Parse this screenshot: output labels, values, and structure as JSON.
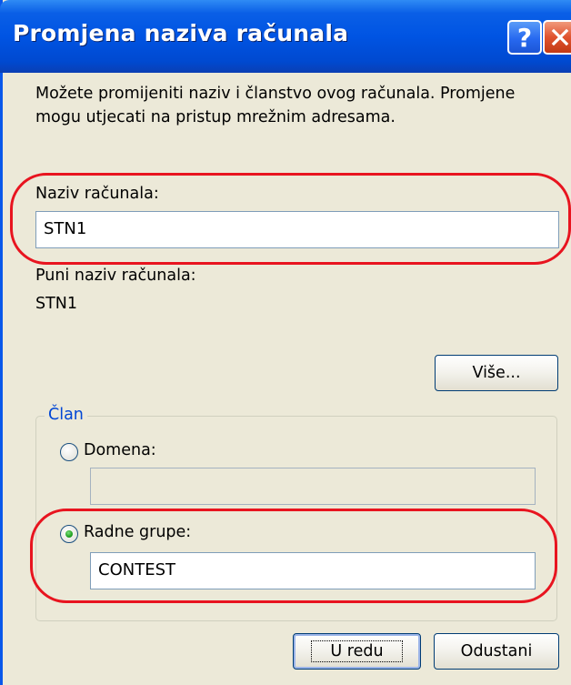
{
  "window": {
    "title": "Promjena naziva računala",
    "help_glyph": "?"
  },
  "intro_text": "Možete promijeniti naziv i članstvo ovog računala. Promjene mogu utjecati na pristup mrežnim adresama.",
  "computer_name": {
    "label": "Naziv računala:",
    "value": "STN1"
  },
  "full_name": {
    "label": "Puni naziv računala:",
    "value": "STN1"
  },
  "more_button": "Više...",
  "member_group": {
    "legend": "Član",
    "domain": {
      "label": "Domena:",
      "value": "",
      "selected": false
    },
    "workgroup": {
      "label": "Radne grupe:",
      "value": "CONTEST",
      "selected": true
    }
  },
  "buttons": {
    "ok": "U redu",
    "cancel": "Odustani"
  },
  "colors": {
    "titlebar": "#0054e3",
    "highlight": "#e8141f",
    "group_legend": "#0046d5",
    "dialog_bg": "#ece9d8"
  },
  "icons": {
    "help": "help-icon",
    "close": "close-icon",
    "radio_selected": "radio-selected-icon"
  }
}
